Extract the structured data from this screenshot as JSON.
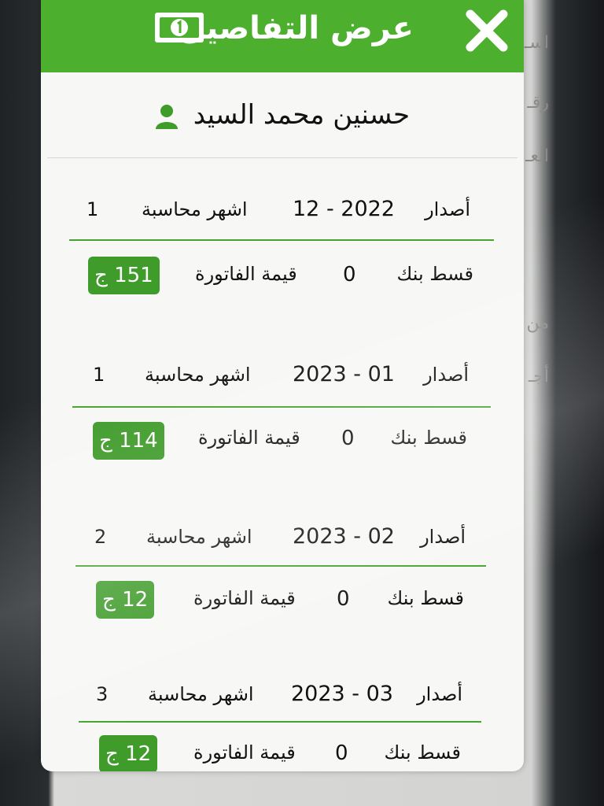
{
  "dialog": {
    "title": "عرض التفاصيل",
    "customer_name": "حسنين محمد السيد"
  },
  "background_text": {
    "line1": "اسـ",
    "line2": "رقـ",
    "line3": "العـ",
    "line4": "من",
    "line5": "أجـ"
  },
  "labels": {
    "issue": "أصدار",
    "months": "اشهر محاسبة",
    "bank": "قسط بنك",
    "invoice": "قيمة الفاتورة"
  },
  "records": [
    {
      "date": "12 - 2022",
      "months": "1",
      "bank": "0",
      "invoice": "151 ج"
    },
    {
      "date": "2023 - 01",
      "months": "1",
      "bank": "0",
      "invoice": "114 ج"
    },
    {
      "date": "2023 - 02",
      "months": "2",
      "bank": "0",
      "invoice": "12 ج"
    },
    {
      "date": "2023 - 03",
      "months": "3",
      "bank": "0",
      "invoice": "12 ج"
    }
  ],
  "colors": {
    "header_green": "#4caf2d",
    "badge_green": "#3f9b2a",
    "line_green": "#47a331"
  }
}
